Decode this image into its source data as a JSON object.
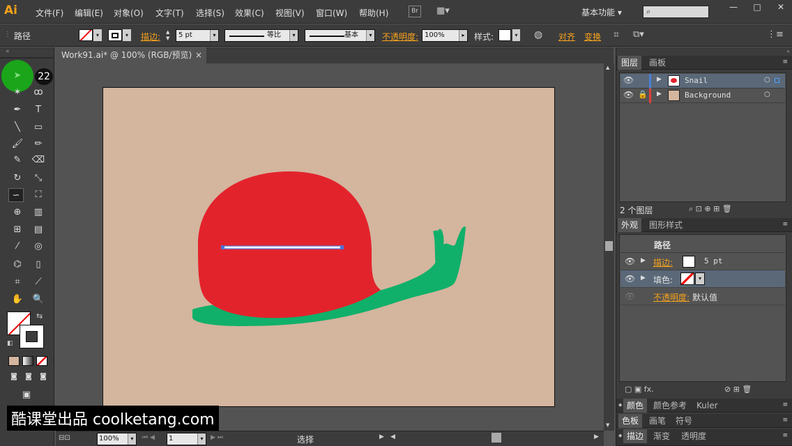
{
  "app": {
    "logo": "Ai",
    "workspace": "基本功能",
    "search_placeholder": "",
    "br": "Br"
  },
  "menu": [
    "文件(F)",
    "编辑(E)",
    "对象(O)",
    "文字(T)",
    "选择(S)",
    "效果(C)",
    "视图(V)",
    "窗口(W)",
    "帮助(H)"
  ],
  "window_buttons": {
    "minimize": "—",
    "maximize": "□",
    "close": "✕"
  },
  "control": {
    "object_type": "路径",
    "stroke_label": "描边:",
    "stroke_weight": "5 pt",
    "profile_label": "等比",
    "brush_label": "基本",
    "opacity_label": "不透明度:",
    "opacity_value": "100%",
    "style_label": "样式:",
    "align_label": "对齐",
    "transform_label": "变换"
  },
  "document": {
    "tab_title": "Work91.ai* @ 100% (RGB/预览)",
    "close": "×"
  },
  "tooltip_number": "22",
  "status": {
    "zoom": "100%",
    "page": "1",
    "tool": "选择"
  },
  "layers_panel": {
    "tabs": [
      "图层",
      "画板"
    ],
    "layers": [
      {
        "name": "Snail",
        "color": "#4a7fd6",
        "locked": false
      },
      {
        "name": "Background",
        "color": "#e0403a",
        "locked": true
      }
    ],
    "count_label": "2 个图层"
  },
  "appearance_panel": {
    "tabs": [
      "外观",
      "图形样式"
    ],
    "title": "路径",
    "rows": [
      {
        "label": "描边:",
        "value": "5 pt"
      },
      {
        "label": "填色:",
        "value": ""
      },
      {
        "label": "不透明度:",
        "value": "默认值"
      }
    ]
  },
  "bottom_panels": [
    {
      "tabs": [
        "颜色",
        "颜色参考",
        "Kuler"
      ]
    },
    {
      "tabs": [
        "色板",
        "画笔",
        "符号"
      ]
    },
    {
      "tabs": [
        "描边",
        "渐变",
        "透明度"
      ]
    }
  ],
  "watermark": "酷课堂出品 coolketang.com",
  "colors": {
    "snail_shell": "#e3232c",
    "snail_body": "#10b06a",
    "artboard": "#d4b59e",
    "accent": "#f7a21b"
  }
}
